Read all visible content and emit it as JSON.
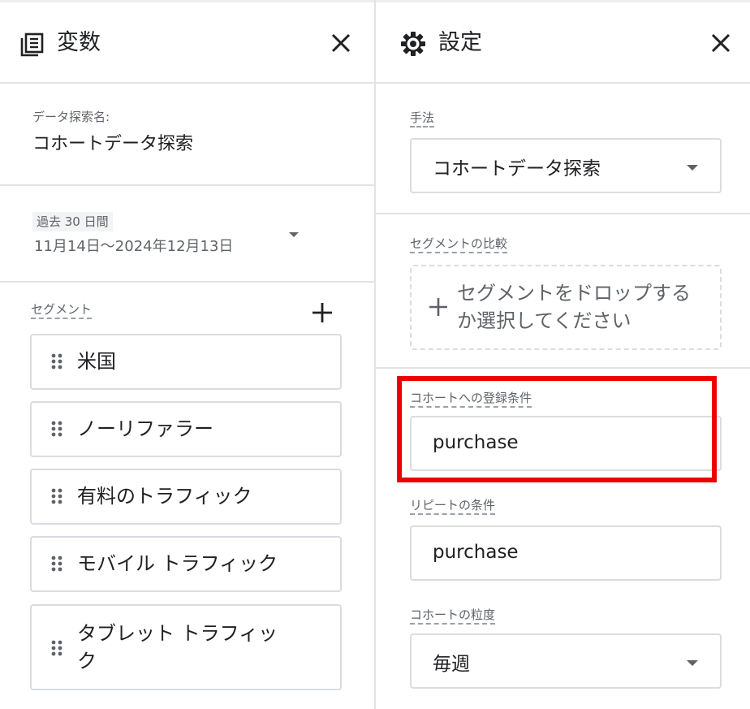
{
  "variables_panel": {
    "title": "変数",
    "icon": "variables-icon",
    "close_icon": "close-icon",
    "exploration_name_label": "データ探索名:",
    "exploration_name": "コホートデータ探索",
    "date_chip": "過去 30 日間",
    "date_range": "11月14日～2024年12月13日",
    "segments_label": "セグメント",
    "segments": [
      {
        "label": "米国"
      },
      {
        "label": "ノーリファラー"
      },
      {
        "label": "有料のトラフィック"
      },
      {
        "label": "モバイル トラフィック"
      },
      {
        "label": "タブレット トラフィッ",
        "label2": "ク"
      }
    ]
  },
  "settings_panel": {
    "title": "設定",
    "icon": "gear-icon",
    "close_icon": "close-icon",
    "technique_label": "手法",
    "technique_value": "コホートデータ探索",
    "segment_compare_label": "セグメントの比較",
    "segment_drop_text": "セグメントをドロップするか選択してください",
    "inclusion_label": "コホートへの登録条件",
    "inclusion_value": "purchase",
    "return_label": "リピートの条件",
    "return_value": "purchase",
    "granularity_label": "コホートの粒度",
    "granularity_value": "毎週"
  },
  "colors": {
    "highlight": "#ee0000",
    "border": "#dadce0",
    "text": "#202124",
    "muted": "#5f6368"
  }
}
